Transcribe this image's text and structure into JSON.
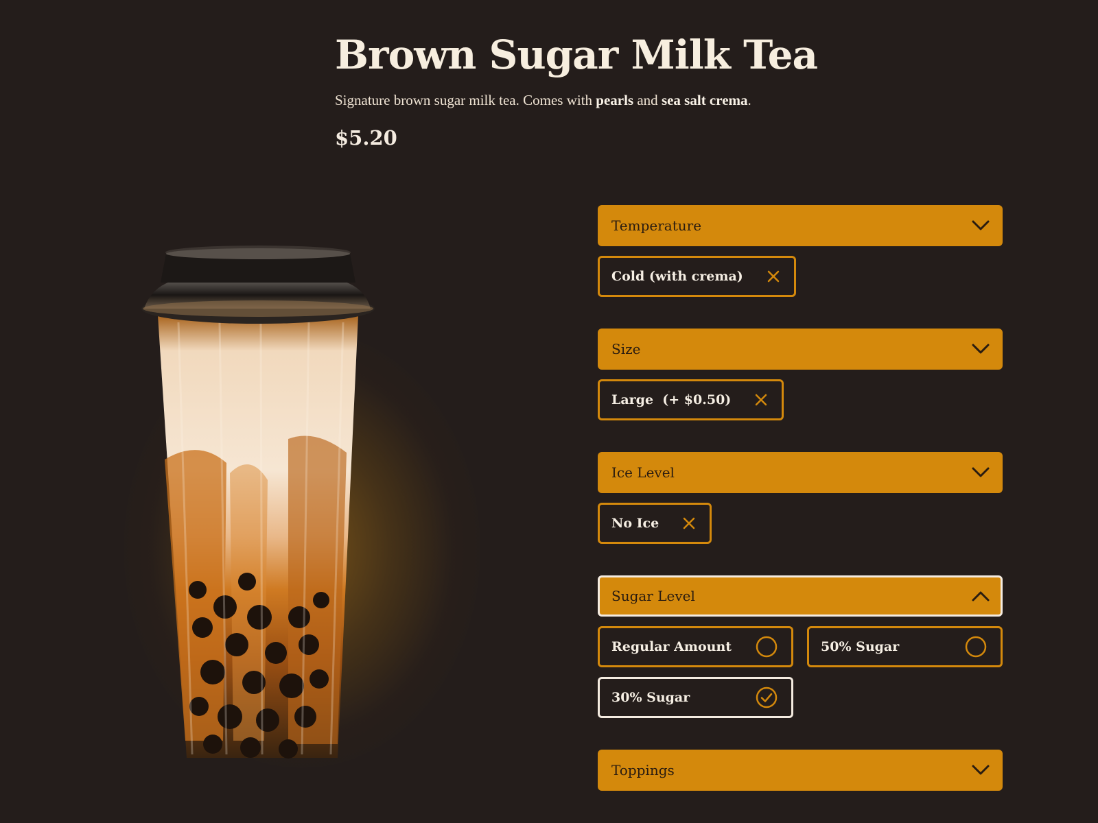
{
  "product": {
    "title": "Brown Sugar Milk Tea",
    "description_prefix": "Signature brown sugar milk tea. Comes with ",
    "description_bold1": "pearls",
    "description_mid": " and ",
    "description_bold2": "sea salt crema",
    "description_suffix": ".",
    "price": "$5.20",
    "image_icon": "bubble-tea-cup-image"
  },
  "accent_color": "#d4890c",
  "background_color": "#241d1b",
  "options": {
    "temperature": {
      "label": "Temperature",
      "expanded": false,
      "selected": "Cold (with crema)"
    },
    "size": {
      "label": "Size",
      "expanded": false,
      "selected": "Large  (+ $0.50)"
    },
    "ice": {
      "label": "Ice Level",
      "expanded": false,
      "selected": "No Ice"
    },
    "sugar": {
      "label": "Sugar Level",
      "expanded": true,
      "choices": [
        {
          "label": "Regular Amount",
          "checked": false
        },
        {
          "label": "50% Sugar",
          "checked": false
        },
        {
          "label": "30% Sugar",
          "checked": true
        }
      ]
    },
    "toppings": {
      "label": "Toppings",
      "expanded": false
    }
  }
}
